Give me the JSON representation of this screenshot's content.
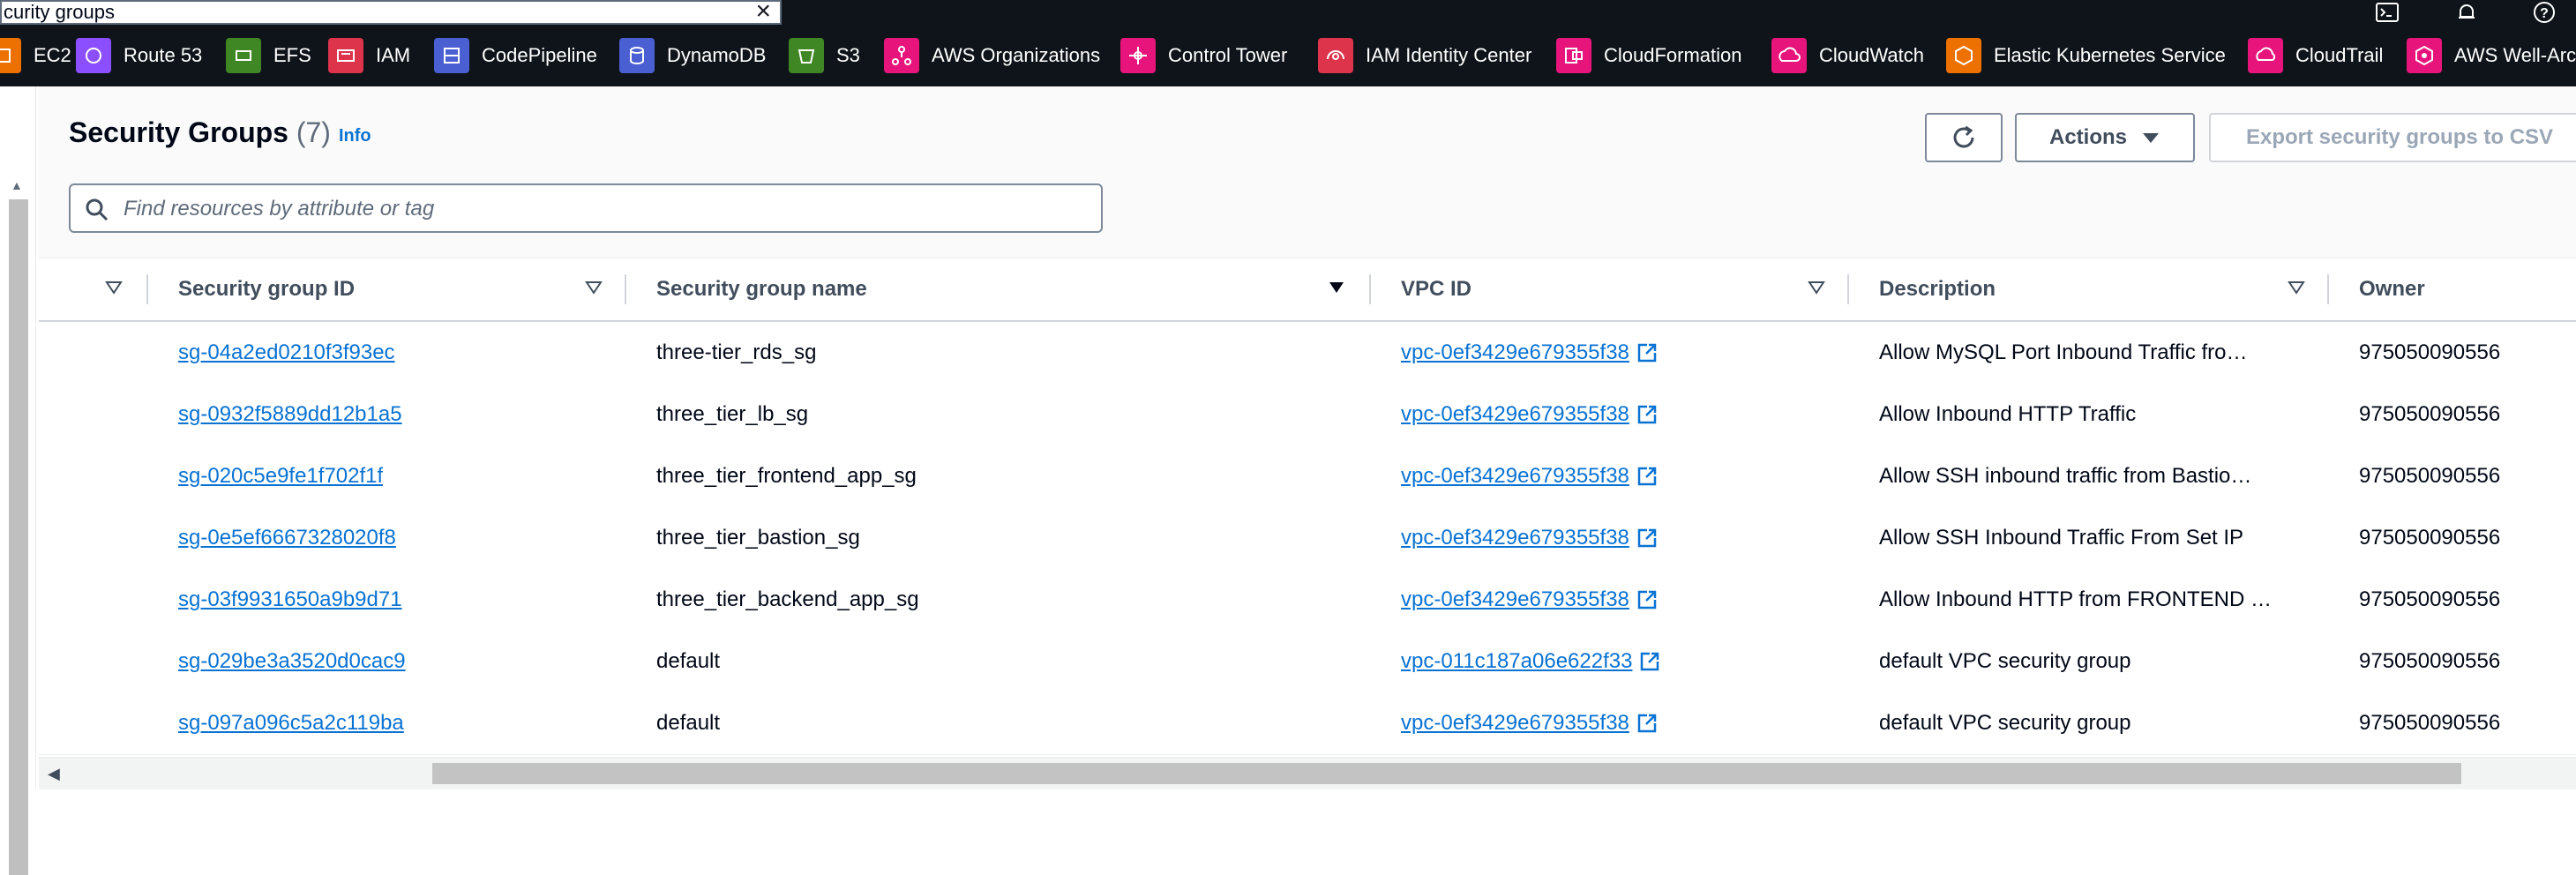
{
  "search": {
    "value": "curity groups"
  },
  "favorites": [
    {
      "label": "EC2",
      "icon": "ec2-icon",
      "color": "#ed7100"
    },
    {
      "label": "Route 53",
      "icon": "route53-icon",
      "color": "#8c4fff"
    },
    {
      "label": "EFS",
      "icon": "efs-icon",
      "color": "#3f8624"
    },
    {
      "label": "IAM",
      "icon": "iam-icon",
      "color": "#dd344c"
    },
    {
      "label": "CodePipeline",
      "icon": "codepipeline-icon",
      "color": "#4a5fd1"
    },
    {
      "label": "DynamoDB",
      "icon": "dynamodb-icon",
      "color": "#4a5fd1"
    },
    {
      "label": "S3",
      "icon": "s3-icon",
      "color": "#3f8624"
    },
    {
      "label": "AWS Organizations",
      "icon": "organizations-icon",
      "color": "#e7157b"
    },
    {
      "label": "Control Tower",
      "icon": "control-tower-icon",
      "color": "#e7157b"
    },
    {
      "label": "IAM Identity Center",
      "icon": "identity-center-icon",
      "color": "#dd344c"
    },
    {
      "label": "CloudFormation",
      "icon": "cloudformation-icon",
      "color": "#e7157b"
    },
    {
      "label": "CloudWatch",
      "icon": "cloudwatch-icon",
      "color": "#e7157b"
    },
    {
      "label": "Elastic Kubernetes Service",
      "icon": "eks-icon",
      "color": "#ed7100"
    },
    {
      "label": "CloudTrail",
      "icon": "cloudtrail-icon",
      "color": "#e7157b"
    },
    {
      "label": "AWS Well-Architected Tool",
      "icon": "well-architected-icon",
      "color": "#e7157b"
    }
  ],
  "header": {
    "title": "Security Groups",
    "count": "(7)",
    "info": "Info",
    "actions_label": "Actions",
    "export_label": "Export security groups to CSV"
  },
  "filter": {
    "placeholder": "Find resources by attribute or tag"
  },
  "table": {
    "columns": [
      "Security group ID",
      "Security group name",
      "VPC ID",
      "Description",
      "Owner"
    ],
    "rows": [
      {
        "id": "sg-04a2ed0210f3f93ec",
        "name": "three-tier_rds_sg",
        "vpc": "vpc-0ef3429e679355f38",
        "desc": "Allow MySQL Port Inbound Traffic fro…",
        "owner": "975050090556"
      },
      {
        "id": "sg-0932f5889dd12b1a5",
        "name": "three_tier_lb_sg",
        "vpc": "vpc-0ef3429e679355f38",
        "desc": "Allow Inbound HTTP Traffic",
        "owner": "975050090556"
      },
      {
        "id": "sg-020c5e9fe1f702f1f",
        "name": "three_tier_frontend_app_sg",
        "vpc": "vpc-0ef3429e679355f38",
        "desc": "Allow SSH inbound traffic from Bastio…",
        "owner": "975050090556"
      },
      {
        "id": "sg-0e5ef6667328020f8",
        "name": "three_tier_bastion_sg",
        "vpc": "vpc-0ef3429e679355f38",
        "desc": "Allow SSH Inbound Traffic From Set IP",
        "owner": "975050090556"
      },
      {
        "id": "sg-03f9931650a9b9d71",
        "name": "three_tier_backend_app_sg",
        "vpc": "vpc-0ef3429e679355f38",
        "desc": "Allow Inbound HTTP from FRONTEND …",
        "owner": "975050090556"
      },
      {
        "id": "sg-029be3a3520d0cac9",
        "name": "default",
        "vpc": "vpc-011c187a06e622f33",
        "desc": "default VPC security group",
        "owner": "975050090556"
      },
      {
        "id": "sg-097a096c5a2c119ba",
        "name": "default",
        "vpc": "vpc-0ef3429e679355f38",
        "desc": "default VPC security group",
        "owner": "975050090556"
      }
    ]
  },
  "colors": {
    "link": "#0972d3",
    "nav_bg": "#0f141a",
    "text": "#000716"
  }
}
